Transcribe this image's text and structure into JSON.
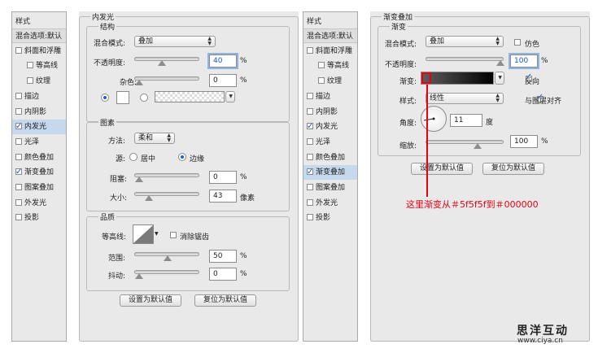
{
  "left": {
    "styles_panel": {
      "title": "样式",
      "items": [
        {
          "label": "混合选项:默认",
          "checkbox": false,
          "header": true
        },
        {
          "label": "斜面和浮雕",
          "checkbox": true,
          "checked": false
        },
        {
          "label": "等高线",
          "checkbox": true,
          "checked": false,
          "indent": true
        },
        {
          "label": "纹理",
          "checkbox": true,
          "checked": false,
          "indent": true
        },
        {
          "label": "描边",
          "checkbox": true,
          "checked": false
        },
        {
          "label": "内阴影",
          "checkbox": true,
          "checked": false
        },
        {
          "label": "内发光",
          "checkbox": true,
          "checked": true,
          "active": true
        },
        {
          "label": "光泽",
          "checkbox": true,
          "checked": false
        },
        {
          "label": "颜色叠加",
          "checkbox": true,
          "checked": false
        },
        {
          "label": "渐变叠加",
          "checkbox": true,
          "checked": true
        },
        {
          "label": "图案叠加",
          "checkbox": true,
          "checked": false
        },
        {
          "label": "外发光",
          "checkbox": true,
          "checked": false
        },
        {
          "label": "投影",
          "checkbox": true,
          "checked": false
        }
      ]
    },
    "inner_glow": {
      "title": "内发光",
      "structure": {
        "title": "结构",
        "blend_mode_label": "混合模式:",
        "blend_mode": "叠加",
        "opacity_label": "不透明度:",
        "opacity": "40",
        "opacity_level": 0.4,
        "noise_label": "杂色:",
        "noise": "0",
        "noise_level": 0
      },
      "elements": {
        "title": "图素",
        "method_label": "方法:",
        "method": "柔和",
        "source_label": "源:",
        "source_center": "居中",
        "source_edge": "边缘",
        "choke_label": "阻塞:",
        "choke": "0",
        "choke_level": 0,
        "size_label": "大小:",
        "size": "43",
        "size_level": 0.17,
        "size_unit": "像素"
      },
      "quality": {
        "title": "品质",
        "contour_label": "等高线:",
        "anti_alias_label": "消除锯齿",
        "range_label": "范围:",
        "range": "50",
        "range_level": 0.5,
        "jitter_label": "抖动:",
        "jitter": "0",
        "jitter_level": 0
      },
      "percent": "%",
      "make_default": "设置为默认值",
      "reset_default": "复位为默认值"
    }
  },
  "right": {
    "styles_panel": {
      "title": "样式",
      "items": [
        {
          "label": "混合选项:默认",
          "checkbox": false,
          "header": true
        },
        {
          "label": "斜面和浮雕",
          "checkbox": true,
          "checked": false
        },
        {
          "label": "等高线",
          "checkbox": true,
          "checked": false,
          "indent": true
        },
        {
          "label": "纹理",
          "checkbox": true,
          "checked": false,
          "indent": true
        },
        {
          "label": "描边",
          "checkbox": true,
          "checked": false
        },
        {
          "label": "内阴影",
          "checkbox": true,
          "checked": false
        },
        {
          "label": "内发光",
          "checkbox": true,
          "checked": true
        },
        {
          "label": "光泽",
          "checkbox": true,
          "checked": false
        },
        {
          "label": "颜色叠加",
          "checkbox": true,
          "checked": false
        },
        {
          "label": "渐变叠加",
          "checkbox": true,
          "checked": true,
          "active": true
        },
        {
          "label": "图案叠加",
          "checkbox": true,
          "checked": false
        },
        {
          "label": "外发光",
          "checkbox": true,
          "checked": false
        },
        {
          "label": "投影",
          "checkbox": true,
          "checked": false
        }
      ]
    },
    "gradient_overlay": {
      "title": "渐变叠加",
      "sub_title": "渐变",
      "blend_mode_label": "混合模式:",
      "blend_mode": "叠加",
      "dither_label": "仿色",
      "opacity_label": "不透明度:",
      "opacity": "100",
      "opacity_level": 1,
      "gradient_label": "渐变:",
      "reverse_label": "反向",
      "style_label": "样式:",
      "style": "线性",
      "align_label": "与图层对齐",
      "angle_label": "角度:",
      "angle": "11",
      "angle_unit": "度",
      "scale_label": "缩放:",
      "scale": "100",
      "scale_level": 0.67,
      "percent": "%",
      "make_default": "设置为默认值",
      "reset_default": "复位为默认值"
    },
    "annotation": "这里渐变从＃5f5f5f到＃000000",
    "gradient_colors": {
      "from": "#5f5f5f",
      "to": "#000000"
    }
  },
  "watermark": {
    "logo": "思洋互动",
    "url": "www.ciya.cn"
  }
}
